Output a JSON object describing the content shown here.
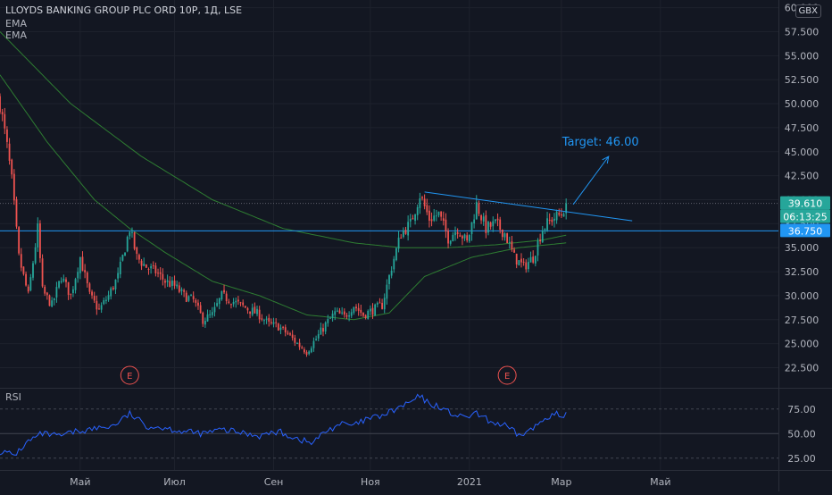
{
  "header": {
    "symbol_title": "LLOYDS BANKING GROUP PLC ORD 10P, 1Д, LSE",
    "indicator_1": "EMA",
    "indicator_2": "EMA",
    "currency": "GBX"
  },
  "rsi_panel": {
    "label": "RSI"
  },
  "annotation": {
    "target_text": "Target: 46.00"
  },
  "earnings_markers": [
    {
      "label": "E",
      "date_index": 55
    },
    {
      "label": "E",
      "date_index": 215
    }
  ],
  "price_labels": {
    "current_price": "39.610",
    "countdown": "06:13:25",
    "horizontal_level": "36.750"
  },
  "colors": {
    "background": "#131722",
    "up_candle": "#26a69a",
    "down_candle": "#ef5350",
    "ema_line": "#2e7d32",
    "rsi_line": "#2962ff",
    "level_line": "#2196f3",
    "trendline": "#2196f3",
    "earnings": "#ef5350",
    "grid": "#1e222d",
    "axis_text": "#b2b5be"
  },
  "chart_data": [
    {
      "type": "candlestick",
      "title": "LLOYDS BANKING GROUP PLC ORD 10P, 1Д, LSE",
      "ylim": [
        20.5,
        60.8
      ],
      "y_ticks": [
        "22.500",
        "25.000",
        "27.500",
        "30.000",
        "32.500",
        "35.000",
        "37.500",
        "40.000",
        "42.500",
        "45.000",
        "47.500",
        "50.000",
        "52.500",
        "55.000",
        "57.500",
        "60.000"
      ],
      "x_ticks": [
        {
          "label": "Май",
          "index": 34
        },
        {
          "label": "Июл",
          "index": 74
        },
        {
          "label": "Сен",
          "index": 116
        },
        {
          "label": "Ноя",
          "index": 157
        },
        {
          "label": "2021",
          "index": 199
        },
        {
          "label": "Мар",
          "index": 238
        },
        {
          "label": "Май",
          "index": 280
        }
      ],
      "x_index_range": [
        0,
        330
      ],
      "close_anchors": [
        [
          0,
          50
        ],
        [
          3,
          45.5
        ],
        [
          5,
          42
        ],
        [
          8,
          34
        ],
        [
          12,
          30
        ],
        [
          16,
          37
        ],
        [
          18,
          30.5
        ],
        [
          22,
          29
        ],
        [
          26,
          32
        ],
        [
          30,
          30
        ],
        [
          34,
          34
        ],
        [
          38,
          30
        ],
        [
          42,
          28.5
        ],
        [
          46,
          30
        ],
        [
          50,
          32
        ],
        [
          55,
          37
        ],
        [
          58,
          34
        ],
        [
          62,
          33
        ],
        [
          66,
          32.5
        ],
        [
          70,
          31.5
        ],
        [
          74,
          31
        ],
        [
          78,
          30
        ],
        [
          82,
          29.5
        ],
        [
          86,
          27.5
        ],
        [
          90,
          28
        ],
        [
          94,
          30
        ],
        [
          98,
          29.5
        ],
        [
          102,
          29
        ],
        [
          106,
          28.5
        ],
        [
          110,
          28
        ],
        [
          114,
          27
        ],
        [
          118,
          26.8
        ],
        [
          122,
          26
        ],
        [
          126,
          25
        ],
        [
          130,
          24.2
        ],
        [
          134,
          25.5
        ],
        [
          138,
          27
        ],
        [
          142,
          28.2
        ],
        [
          146,
          27.8
        ],
        [
          150,
          29
        ],
        [
          154,
          28
        ],
        [
          158,
          28.5
        ],
        [
          162,
          29
        ],
        [
          166,
          33
        ],
        [
          170,
          36.5
        ],
        [
          174,
          37.5
        ],
        [
          178,
          40.5
        ],
        [
          182,
          38
        ],
        [
          186,
          38.5
        ],
        [
          190,
          36
        ],
        [
          194,
          37
        ],
        [
          198,
          35.5
        ],
        [
          202,
          39.5
        ],
        [
          206,
          37
        ],
        [
          210,
          37.5
        ],
        [
          214,
          36.5
        ],
        [
          218,
          34
        ],
        [
          222,
          33
        ],
        [
          226,
          34
        ],
        [
          230,
          37
        ],
        [
          234,
          38
        ],
        [
          238,
          38.5
        ],
        [
          240,
          39.6
        ]
      ],
      "ema_fast": [
        [
          0,
          53
        ],
        [
          20,
          46
        ],
        [
          40,
          40
        ],
        [
          55,
          37
        ],
        [
          70,
          34.5
        ],
        [
          90,
          31.5
        ],
        [
          110,
          30
        ],
        [
          130,
          28
        ],
        [
          150,
          27.5
        ],
        [
          165,
          28.2
        ],
        [
          180,
          32
        ],
        [
          200,
          34
        ],
        [
          220,
          35
        ],
        [
          240,
          35.5
        ]
      ],
      "ema_slow": [
        [
          0,
          57.5
        ],
        [
          30,
          50
        ],
        [
          60,
          44.5
        ],
        [
          90,
          40
        ],
        [
          120,
          37
        ],
        [
          150,
          35.5
        ],
        [
          170,
          35
        ],
        [
          190,
          35
        ],
        [
          210,
          35.3
        ],
        [
          230,
          35.8
        ],
        [
          240,
          36.3
        ]
      ],
      "horizontal_level": 36.75,
      "current_price_line": 39.61,
      "trendline": [
        [
          180,
          40.8
        ],
        [
          268,
          37.8
        ]
      ],
      "target_arrow": [
        [
          243,
          39.5
        ],
        [
          258,
          44.5
        ]
      ],
      "target_value": 46.0
    },
    {
      "type": "line",
      "title": "RSI",
      "ylim": [
        13,
        93
      ],
      "y_ticks": [
        "25.00",
        "50.00",
        "75.00"
      ],
      "levels": [
        25,
        50,
        75
      ],
      "rsi_anchors": [
        [
          0,
          32
        ],
        [
          6,
          28
        ],
        [
          12,
          42
        ],
        [
          18,
          50
        ],
        [
          25,
          47
        ],
        [
          32,
          52
        ],
        [
          40,
          55
        ],
        [
          48,
          58
        ],
        [
          55,
          70
        ],
        [
          62,
          58
        ],
        [
          70,
          56
        ],
        [
          78,
          52
        ],
        [
          86,
          50
        ],
        [
          94,
          54
        ],
        [
          102,
          51
        ],
        [
          110,
          48
        ],
        [
          118,
          52
        ],
        [
          126,
          45
        ],
        [
          132,
          40
        ],
        [
          138,
          52
        ],
        [
          144,
          60
        ],
        [
          150,
          58
        ],
        [
          156,
          65
        ],
        [
          162,
          68
        ],
        [
          168,
          75
        ],
        [
          174,
          82
        ],
        [
          178,
          88
        ],
        [
          182,
          80
        ],
        [
          186,
          78
        ],
        [
          190,
          72
        ],
        [
          196,
          66
        ],
        [
          202,
          70
        ],
        [
          208,
          62
        ],
        [
          214,
          58
        ],
        [
          220,
          48
        ],
        [
          226,
          55
        ],
        [
          232,
          68
        ],
        [
          236,
          70
        ],
        [
          238,
          65
        ],
        [
          240,
          69
        ]
      ]
    }
  ]
}
